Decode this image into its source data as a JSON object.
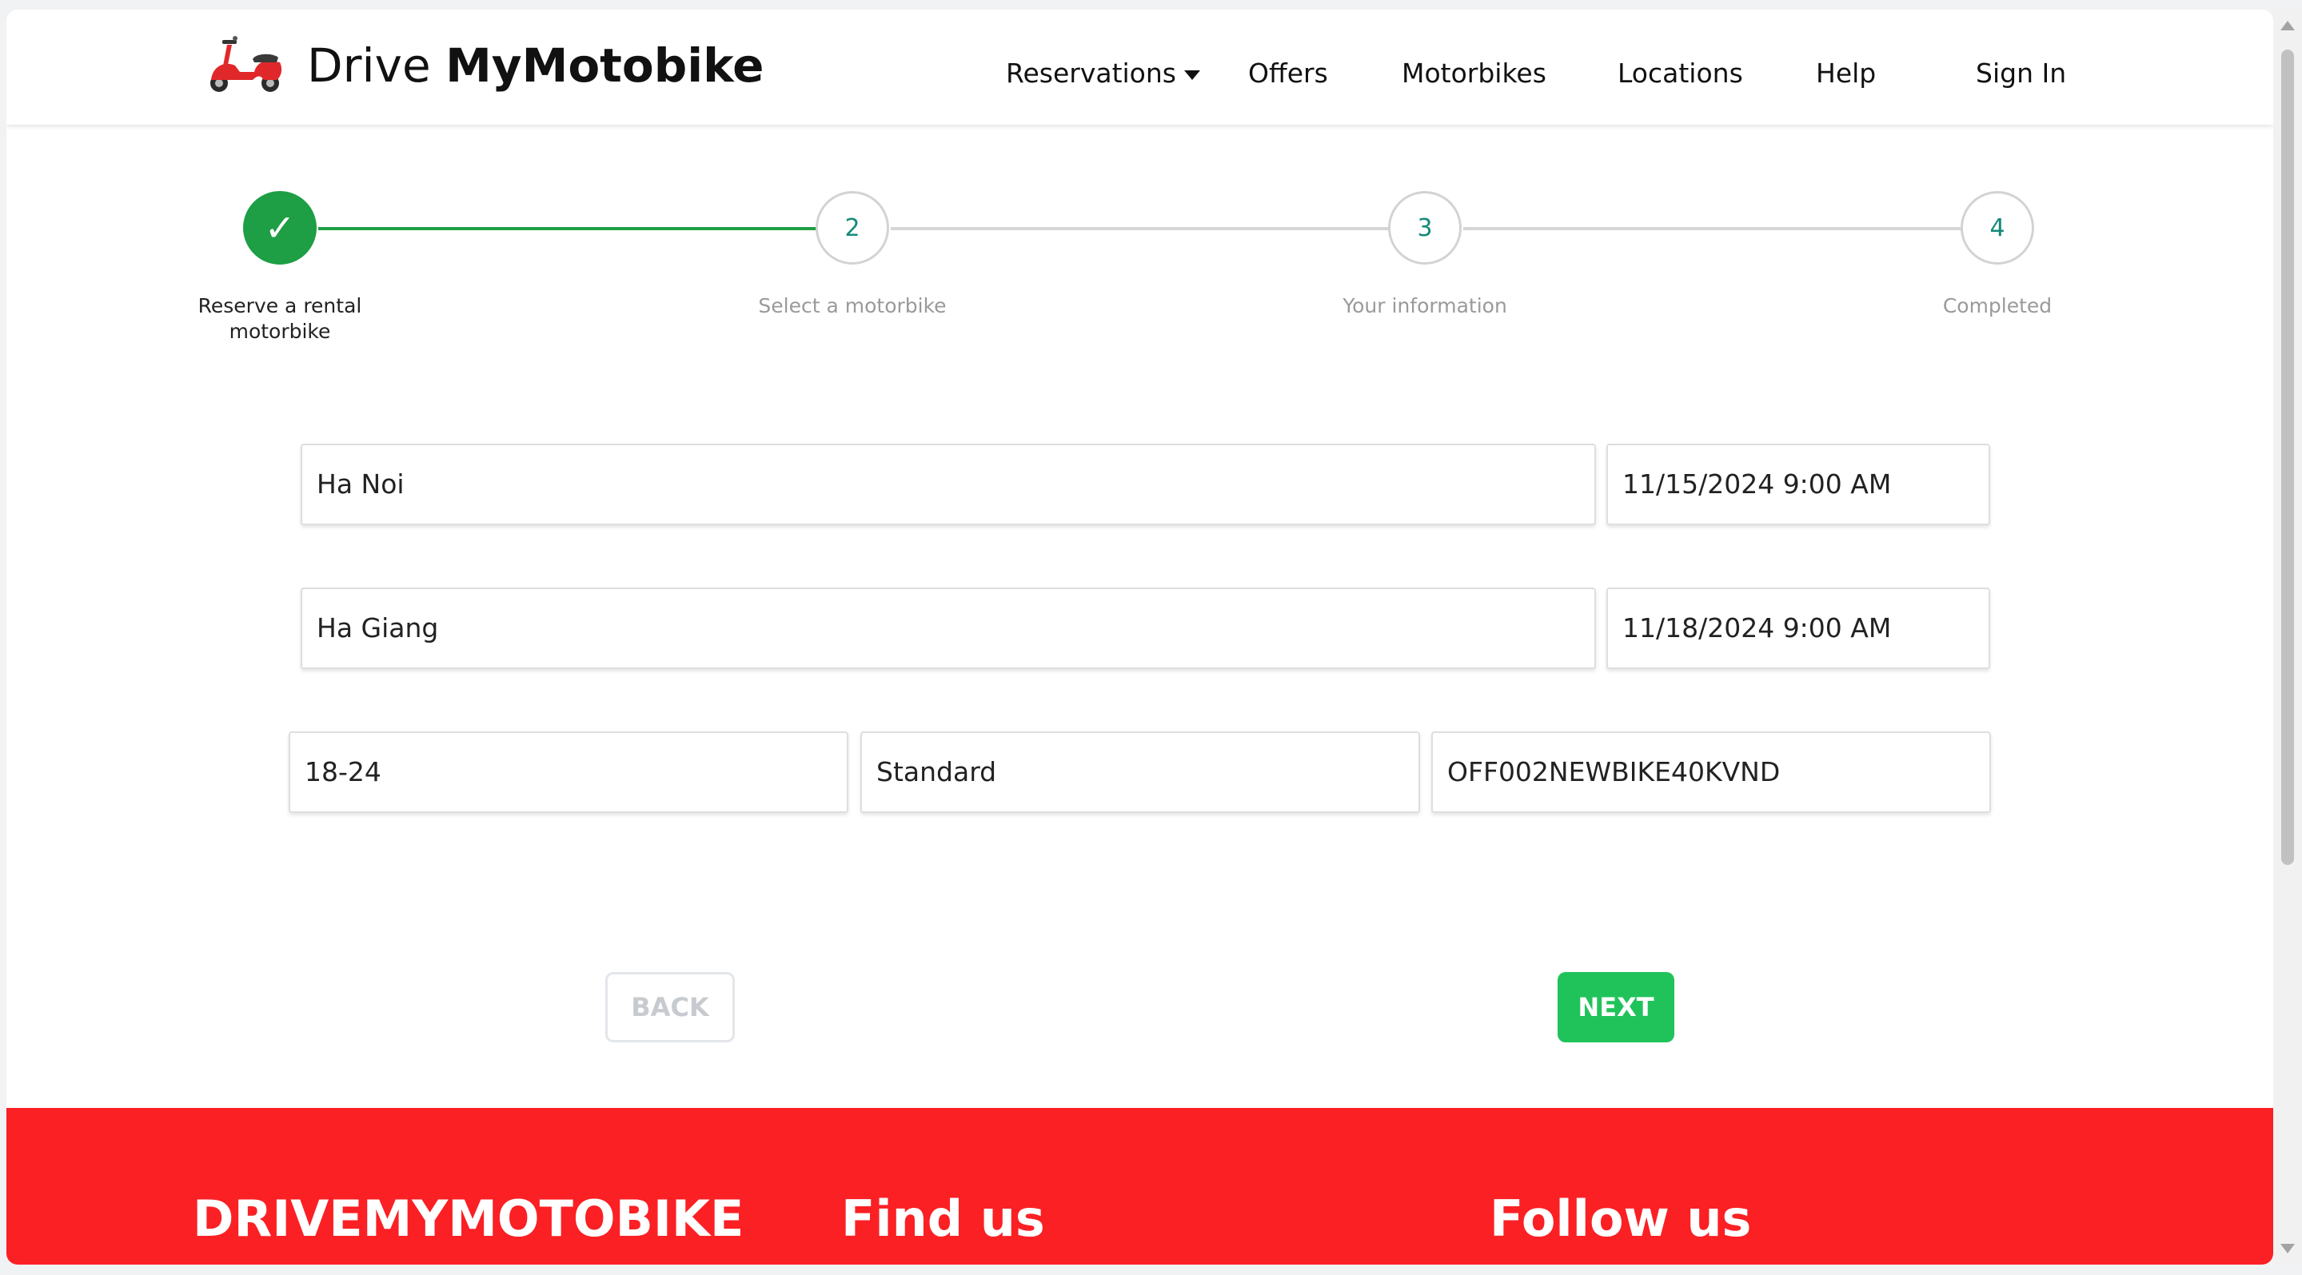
{
  "brand": {
    "prefix": "Drive",
    "name": "MyMotobike"
  },
  "nav": {
    "reservations": "Reservations",
    "offers": "Offers",
    "motorbikes": "Motorbikes",
    "locations": "Locations",
    "help": "Help",
    "sign_in": "Sign In"
  },
  "stepper": {
    "steps": [
      {
        "number": "✓",
        "label": "Reserve a rental motorbike",
        "status": "done"
      },
      {
        "number": "2",
        "label": "Select a motorbike",
        "status": "pending"
      },
      {
        "number": "3",
        "label": "Your information",
        "status": "pending"
      },
      {
        "number": "4",
        "label": "Completed",
        "status": "pending"
      }
    ]
  },
  "form": {
    "pickup_location": "Ha Noi",
    "pickup_datetime": "11/15/2024 9:00 AM",
    "dropoff_location": "Ha Giang",
    "dropoff_datetime": "11/18/2024 9:00 AM",
    "age_range": "18-24",
    "motorbike_type": "Standard",
    "promo_code": "OFF002NEWBIKE40KVND"
  },
  "buttons": {
    "back": "BACK",
    "next": "NEXT"
  },
  "footer": {
    "brand": "DRIVEMYMOTOBIKE",
    "find_us": "Find us",
    "follow_us": "Follow us"
  },
  "colors": {
    "accent_green": "#1e9e45",
    "next_button": "#20c35a",
    "footer_red": "#fa2024",
    "step_number": "#15897a"
  },
  "icons": {
    "logo": "red-scooter-icon"
  }
}
